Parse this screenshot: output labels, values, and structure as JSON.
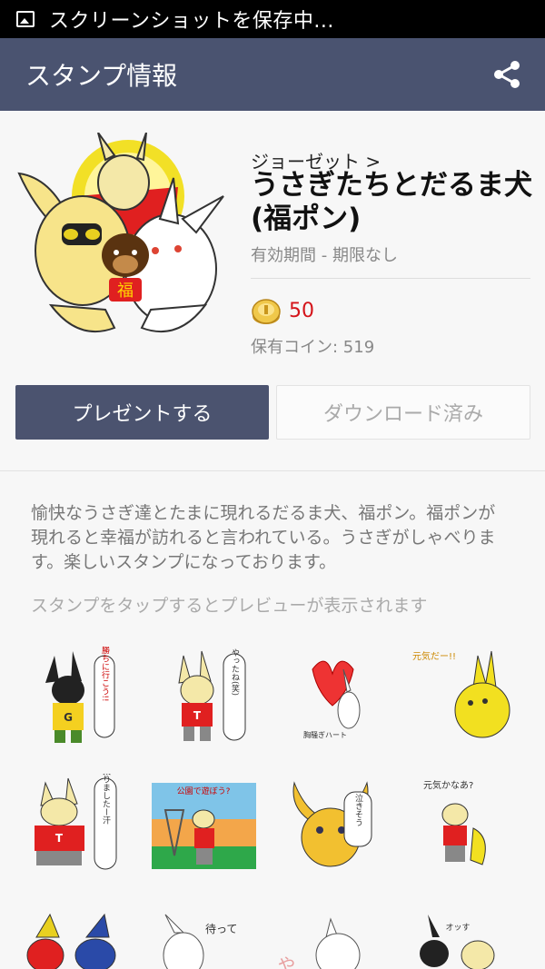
{
  "status_bar": {
    "text": "スクリーンショットを保存中..."
  },
  "app_bar": {
    "title": "スタンプ情報",
    "share_icon": "share-icon"
  },
  "package": {
    "author": "ジョーゼット >",
    "title": "うさぎたちとだるま犬(福ポン)",
    "validity": "有効期間 - 期限なし",
    "price": "50",
    "balance": "保有コイン: 519",
    "main_sticker_text": "福"
  },
  "buttons": {
    "present": "プレゼントする",
    "downloaded": "ダウンロード済み"
  },
  "description": "愉快なうさぎ達とたまに現れるだるま犬、福ポン。福ポンが現れると幸福が訪れると言われている。うさぎがしゃべります。楽しいスタンプになっております。",
  "preview_hint": "スタンプをタップするとプレビューが表示されます",
  "stickers": [
    {
      "text": "勝ちに行こう!!"
    },
    {
      "text": "やったね(笑)"
    },
    {
      "text": "胸騒ぎハート"
    },
    {
      "text": "元気だー!!"
    },
    {
      "text": "太りましたー汗"
    },
    {
      "text": "公園で遊ぼう?"
    },
    {
      "text": "泣きそう"
    },
    {
      "text": "元気かなあ?"
    },
    {
      "text": ""
    },
    {
      "text": "待って"
    },
    {
      "text": "やあ"
    },
    {
      "text": "オッす"
    }
  ],
  "colors": {
    "app_bar": "#4a5370",
    "present_button": "#4b536f",
    "price": "#d4141a"
  }
}
